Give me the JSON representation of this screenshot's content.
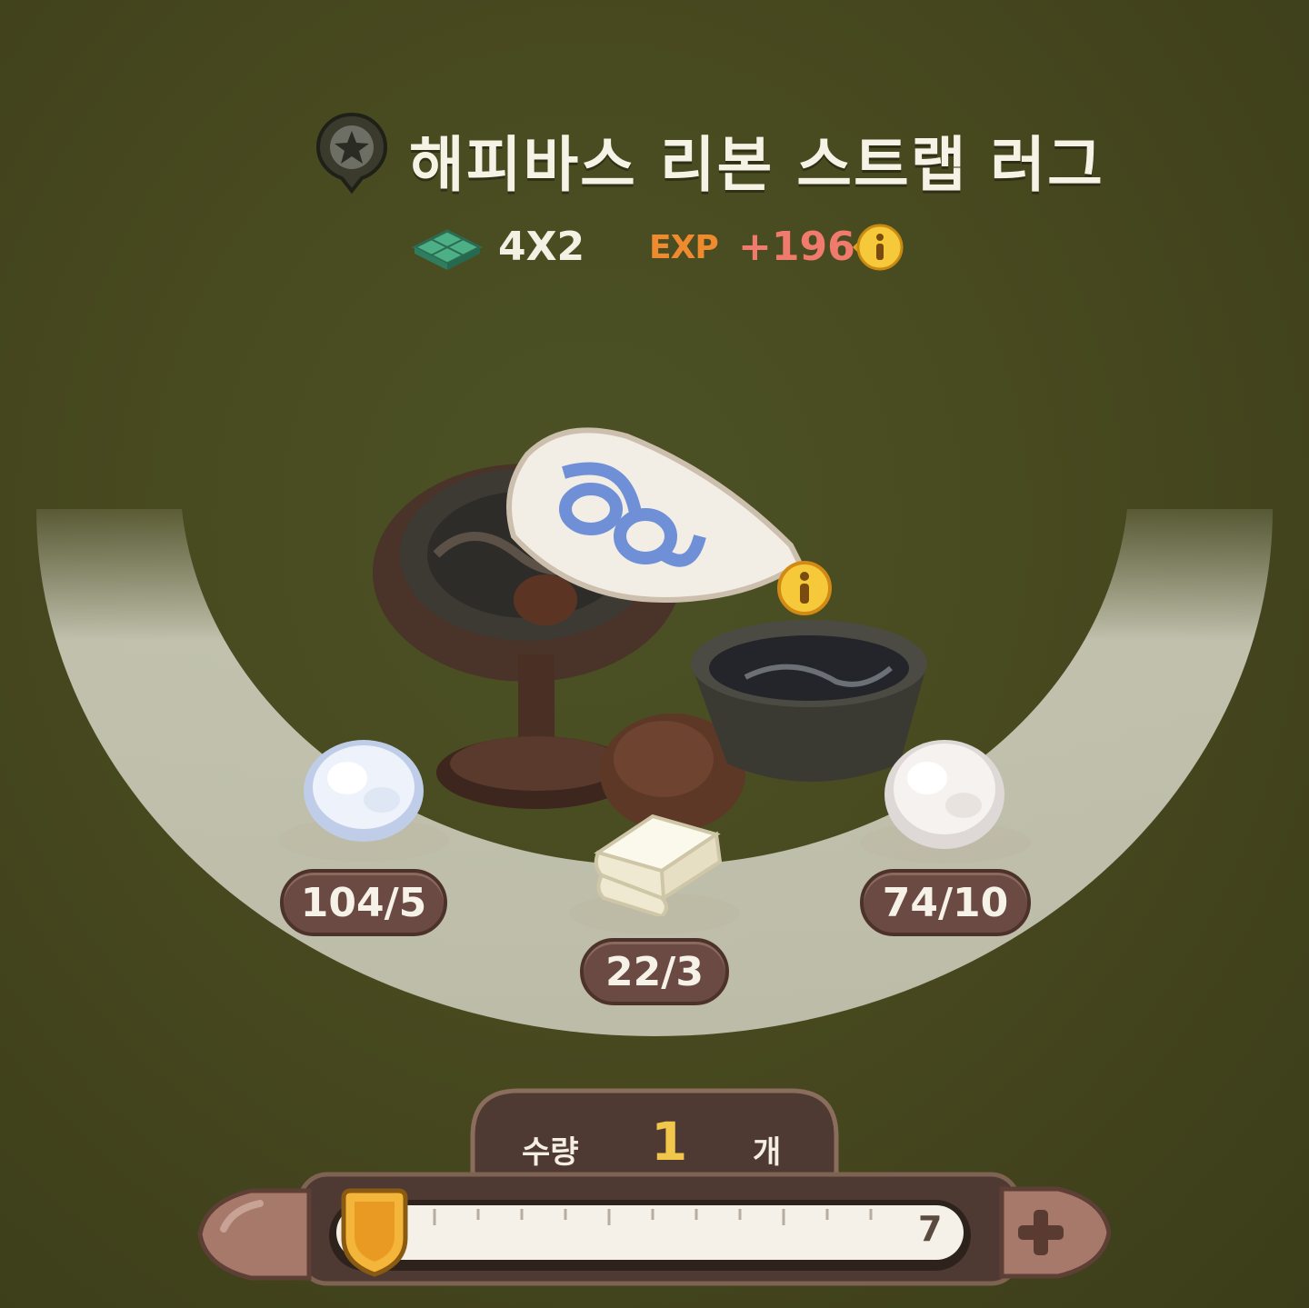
{
  "item": {
    "name": "해피바스 리본 스트랩 러그",
    "size": "4X2",
    "exp_label": "EXP",
    "exp_value": "+196"
  },
  "icons": {
    "title_badge": "star-pin-icon",
    "size": "floor-tile-icon",
    "exp_info": "info-icon",
    "product_info": "info-icon",
    "plus": "plus-icon"
  },
  "materials": [
    {
      "name": "blue-fluff",
      "count": "104/5"
    },
    {
      "name": "folded-cloth",
      "count": "22/3"
    },
    {
      "name": "white-fluff",
      "count": "74/10"
    }
  ],
  "quantity": {
    "label": "수량",
    "value": "1",
    "unit": "개",
    "max": "7"
  },
  "colors": {
    "background": "#48491f",
    "accent_gold": "#f2c64a",
    "exp_orange": "#ee8b2e",
    "exp_value": "#f07b6c",
    "pill_brown": "#6a4a42"
  }
}
